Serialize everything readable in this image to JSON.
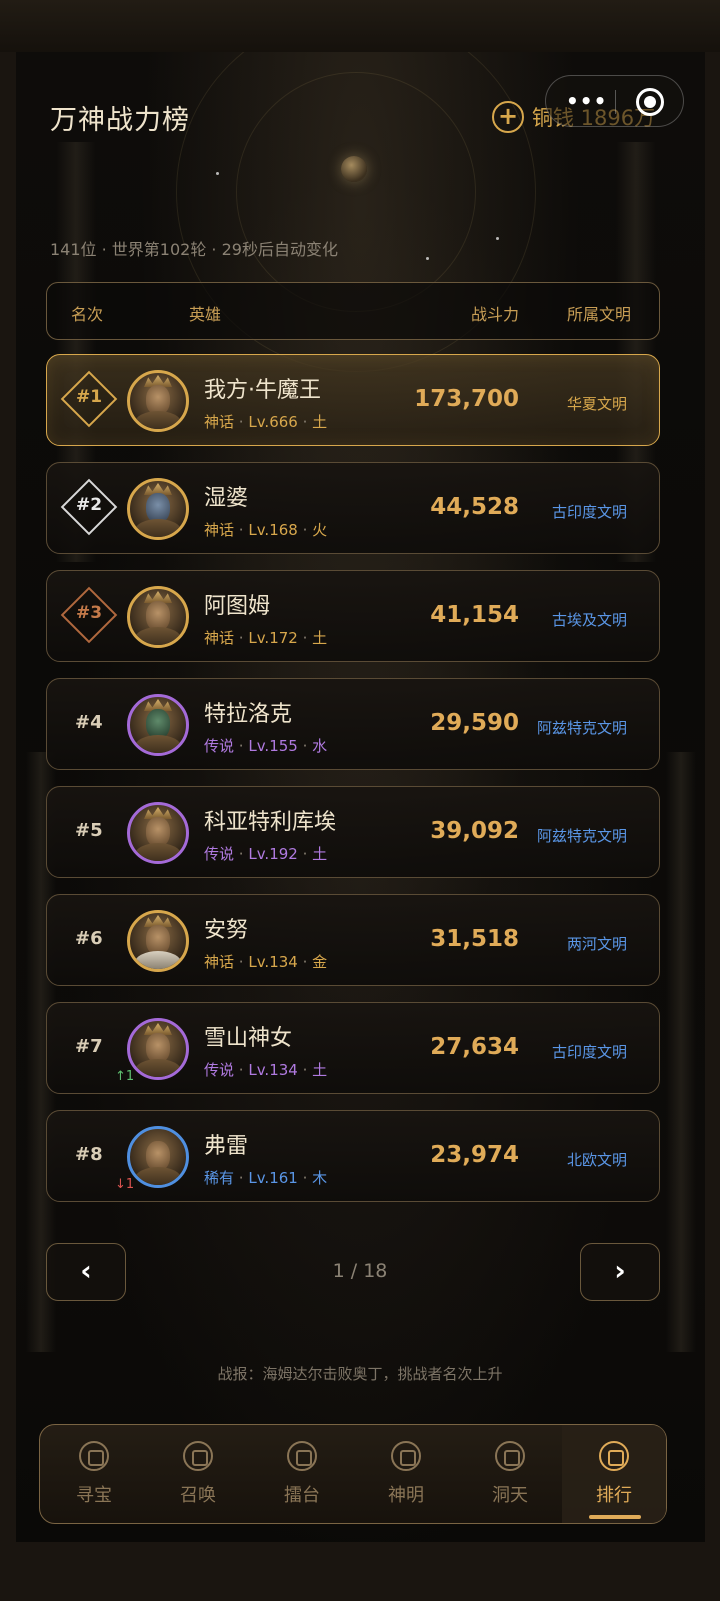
{
  "page": {
    "title": "万神战力榜",
    "meta": "141位 · 世界第102轮 · 29秒后自动变化"
  },
  "currency": {
    "label": "铜钱 1896万",
    "add_icon": "plus-icon"
  },
  "capsule": {
    "more_icon": "more-dots-icon",
    "close_icon": "target-icon"
  },
  "table_header": {
    "rank": "名次",
    "hero": "英雄",
    "power": "战斗力",
    "civ": "所属文明"
  },
  "rows": [
    {
      "rank": "#1",
      "name": "我方·牛魔王",
      "rarity": "神话",
      "level": "Lv.666",
      "element": "土",
      "power": "173,700",
      "civ": "华夏文明",
      "rarity_class": "myth",
      "trend": ""
    },
    {
      "rank": "#2",
      "name": "湿婆",
      "rarity": "神话",
      "level": "Lv.168",
      "element": "火",
      "power": "44,528",
      "civ": "古印度文明",
      "rarity_class": "myth",
      "trend": ""
    },
    {
      "rank": "#3",
      "name": "阿图姆",
      "rarity": "神话",
      "level": "Lv.172",
      "element": "土",
      "power": "41,154",
      "civ": "古埃及文明",
      "rarity_class": "myth",
      "trend": ""
    },
    {
      "rank": "#4",
      "name": "特拉洛克",
      "rarity": "传说",
      "level": "Lv.155",
      "element": "水",
      "power": "29,590",
      "civ": "阿兹特克文明",
      "rarity_class": "legend",
      "trend": ""
    },
    {
      "rank": "#5",
      "name": "科亚特利库埃",
      "rarity": "传说",
      "level": "Lv.192",
      "element": "土",
      "power": "39,092",
      "civ": "阿兹特克文明",
      "rarity_class": "legend",
      "trend": ""
    },
    {
      "rank": "#6",
      "name": "安努",
      "rarity": "神话",
      "level": "Lv.134",
      "element": "金",
      "power": "31,518",
      "civ": "两河文明",
      "rarity_class": "myth",
      "trend": ""
    },
    {
      "rank": "#7",
      "name": "雪山神女",
      "rarity": "传说",
      "level": "Lv.134",
      "element": "土",
      "power": "27,634",
      "civ": "古印度文明",
      "rarity_class": "legend",
      "trend": "↑1"
    },
    {
      "rank": "#8",
      "name": "弗雷",
      "rarity": "稀有",
      "level": "Lv.161",
      "element": "木",
      "power": "23,974",
      "civ": "北欧文明",
      "rarity_class": "rare",
      "trend": "↓1"
    }
  ],
  "separator": "·",
  "pager": {
    "prev": "‹",
    "next": "›",
    "indicator": "1 / 18"
  },
  "news": "战报：海姆达尔击败奥丁，挑战者名次上升",
  "nav": [
    {
      "label": "寻宝",
      "icon": "treasure-icon",
      "active": false
    },
    {
      "label": "召唤",
      "icon": "summon-icon",
      "active": false
    },
    {
      "label": "擂台",
      "icon": "arena-icon",
      "active": false
    },
    {
      "label": "神明",
      "icon": "gods-icon",
      "active": false
    },
    {
      "label": "洞天",
      "icon": "cave-icon",
      "active": false
    },
    {
      "label": "排行",
      "icon": "ranking-icon",
      "active": true
    }
  ]
}
